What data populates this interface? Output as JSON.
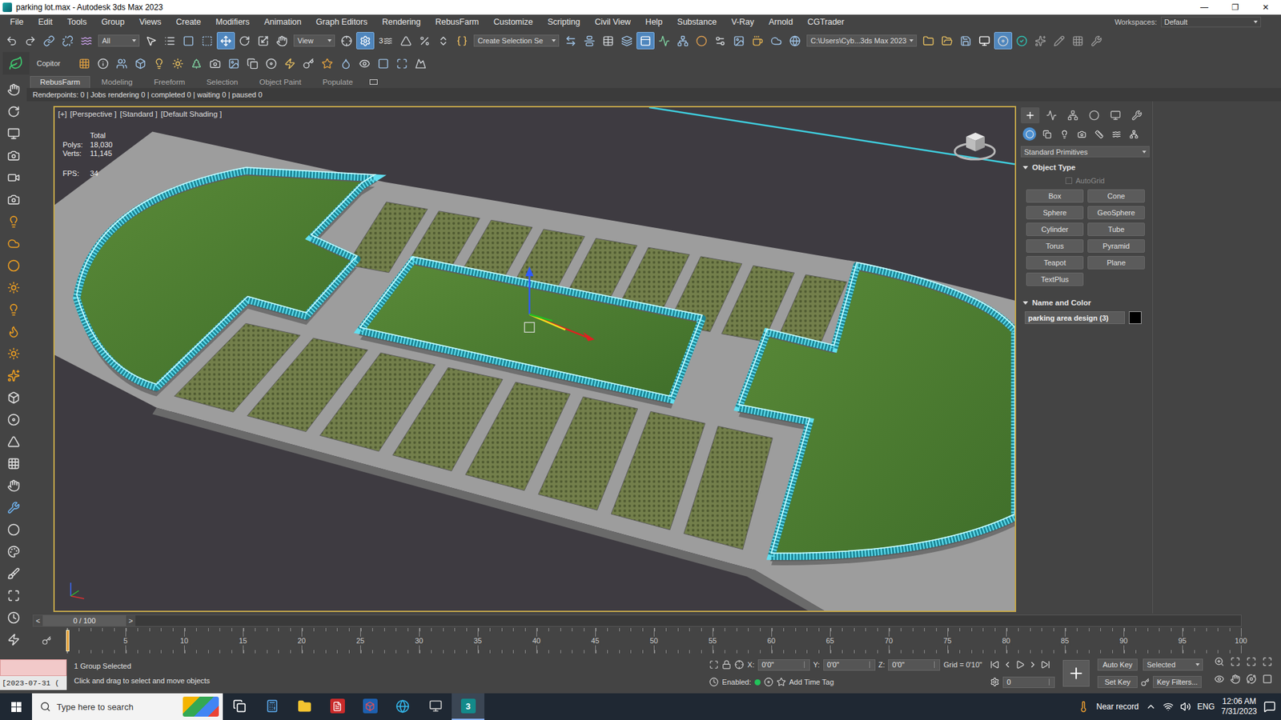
{
  "window": {
    "title": "parking lot.max - Autodesk 3ds Max 2023",
    "controls": [
      "—",
      "❐",
      "✕"
    ]
  },
  "menu": {
    "items": [
      "File",
      "Edit",
      "Tools",
      "Group",
      "Views",
      "Create",
      "Modifiers",
      "Animation",
      "Graph Editors",
      "Rendering",
      "RebusFarm",
      "Customize",
      "Scripting",
      "Civil View",
      "Help",
      "Substance",
      "V-Ray",
      "Arnold",
      "CGTrader"
    ],
    "workspaces_label": "Workspaces:",
    "workspace": "Default"
  },
  "main_toolbar": {
    "items": [
      {
        "kind": "icon",
        "selected": false
      },
      {
        "kind": "icon",
        "selected": false
      },
      {
        "kind": "icon",
        "selected": false
      },
      {
        "kind": "icon",
        "selected": false
      },
      {
        "kind": "icon",
        "selected": false
      },
      {
        "kind": "dropdown",
        "value": "All"
      },
      {
        "kind": "icon",
        "selected": false
      },
      {
        "kind": "icon",
        "selected": false
      },
      {
        "kind": "icon",
        "selected": false
      },
      {
        "kind": "icon",
        "selected": false
      },
      {
        "kind": "icon",
        "selected": true
      },
      {
        "kind": "icon",
        "selected": false
      },
      {
        "kind": "icon",
        "selected": false
      },
      {
        "kind": "icon",
        "selected": false
      },
      {
        "kind": "dropdown",
        "value": "View"
      },
      {
        "kind": "icon",
        "selected": false
      },
      {
        "kind": "icon",
        "selected": true
      },
      {
        "kind": "snap",
        "value": "3",
        "selected": false
      },
      {
        "kind": "icon",
        "selected": false
      },
      {
        "kind": "icon",
        "selected": false
      },
      {
        "kind": "icon",
        "selected": false
      },
      {
        "kind": "icon",
        "selected": false
      },
      {
        "kind": "dropdown",
        "value": "Create Selection Se"
      },
      {
        "kind": "icon",
        "selected": false
      },
      {
        "kind": "icon",
        "selected": false
      },
      {
        "kind": "icon",
        "selected": false
      },
      {
        "kind": "icon",
        "selected": false
      },
      {
        "kind": "icon",
        "selected": true
      },
      {
        "kind": "icon",
        "selected": false
      },
      {
        "kind": "icon",
        "selected": false
      },
      {
        "kind": "icon",
        "selected": false
      },
      {
        "kind": "icon",
        "selected": false
      },
      {
        "kind": "icon",
        "selected": false
      },
      {
        "kind": "icon",
        "selected": false
      },
      {
        "kind": "icon",
        "selected": false
      },
      {
        "kind": "icon",
        "selected": false
      },
      {
        "kind": "dropdown",
        "value": "C:\\Users\\Cyb...3ds Max 2023"
      },
      {
        "kind": "icon",
        "selected": false
      },
      {
        "kind": "icon",
        "selected": false
      },
      {
        "kind": "icon",
        "selected": false
      },
      {
        "kind": "icon",
        "selected": false
      },
      {
        "kind": "icon",
        "selected": true
      },
      {
        "kind": "icon",
        "selected": false
      },
      {
        "kind": "icon",
        "selected": false
      },
      {
        "kind": "icon",
        "selected": false
      },
      {
        "kind": "icon",
        "selected": false
      },
      {
        "kind": "icon",
        "selected": false
      }
    ]
  },
  "second_toolbar": {
    "label": "Copitor"
  },
  "ribbon_tabs": [
    {
      "label": "RebusFarm",
      "selected": true
    },
    {
      "label": "Modeling",
      "selected": false
    },
    {
      "label": "Freeform",
      "selected": false
    },
    {
      "label": "Selection",
      "selected": false
    },
    {
      "label": "Object Paint",
      "selected": false
    },
    {
      "label": "Populate",
      "selected": false
    }
  ],
  "rebus_status": "Renderpoints: 0 | Jobs rendering 0 | completed 0 | waiting 0 | paused 0",
  "viewport": {
    "active": true,
    "labels": [
      "[+]",
      "[Perspective ]",
      "[Standard ]",
      "[Default Shading ]"
    ],
    "stats_title": "Total",
    "stats": [
      {
        "label": "Polys:",
        "value": "18,030"
      },
      {
        "label": "Verts:",
        "value": "11,145"
      }
    ],
    "fps": {
      "label": "FPS:",
      "value": "34"
    }
  },
  "command_panel": {
    "tabs": [
      {
        "selected": true
      },
      {
        "selected": false
      },
      {
        "selected": false
      },
      {
        "selected": false
      },
      {
        "selected": false
      },
      {
        "selected": false
      }
    ],
    "categories": [
      {
        "selected": true
      },
      {
        "selected": false
      },
      {
        "selected": false
      },
      {
        "selected": false
      },
      {
        "selected": false
      },
      {
        "selected": false
      },
      {
        "selected": false
      }
    ],
    "dropdown": "Standard Primitives",
    "object_type": {
      "title": "Object Type",
      "expanded": true,
      "autogrid": {
        "label": "AutoGrid",
        "checked": false,
        "disabled": true
      },
      "buttons": [
        "Box",
        "Cone",
        "Sphere",
        "GeoSphere",
        "Cylinder",
        "Tube",
        "Torus",
        "Pyramid",
        "Teapot",
        "Plane",
        "TextPlus"
      ]
    },
    "name_color": {
      "title": "Name and Color",
      "expanded": true,
      "name": "parking area design (3)",
      "color": "#000000"
    }
  },
  "time_slider": {
    "label": "0 / 100",
    "prev": "<",
    "next": ">",
    "level": 0
  },
  "ruler": {
    "ticks": [
      "5",
      "10",
      "15",
      "20",
      "25",
      "30",
      "35",
      "40",
      "45",
      "50",
      "55",
      "60",
      "65",
      "70",
      "75",
      "80",
      "85",
      "90",
      "95",
      "100"
    ]
  },
  "status": {
    "listener": "[2023-07-31 (",
    "selection": "1 Group Selected",
    "prompt": "Click and drag to select and move objects",
    "coords": [
      {
        "label": "X:",
        "value": "0'0\""
      },
      {
        "label": "Y:",
        "value": "0'0\""
      },
      {
        "label": "Z:",
        "value": "0'0\""
      }
    ],
    "grid": "Grid = 0'10\"",
    "enabled_label": "Enabled:",
    "enabled": true,
    "time_tag": "Add Time Tag",
    "auto_key": "Auto Key",
    "key_mode": "Selected",
    "set_key": "Set Key",
    "key_filters": "Key Filters...",
    "frame": "0"
  },
  "taskbar": {
    "search": "Type here to search",
    "apps": [
      {
        "kind": "taskview",
        "selected": false
      },
      {
        "kind": "calculator",
        "selected": false
      },
      {
        "kind": "explorer",
        "selected": false
      },
      {
        "kind": "acrobat",
        "selected": false
      },
      {
        "kind": "sketchup",
        "selected": false
      },
      {
        "kind": "edge",
        "selected": false
      },
      {
        "kind": "app",
        "selected": false
      },
      {
        "kind": "max",
        "selected": true,
        "label": "3"
      }
    ],
    "weather": "Near record",
    "lang": "ENG",
    "time": "12:06 AM",
    "date": "7/31/2023"
  }
}
